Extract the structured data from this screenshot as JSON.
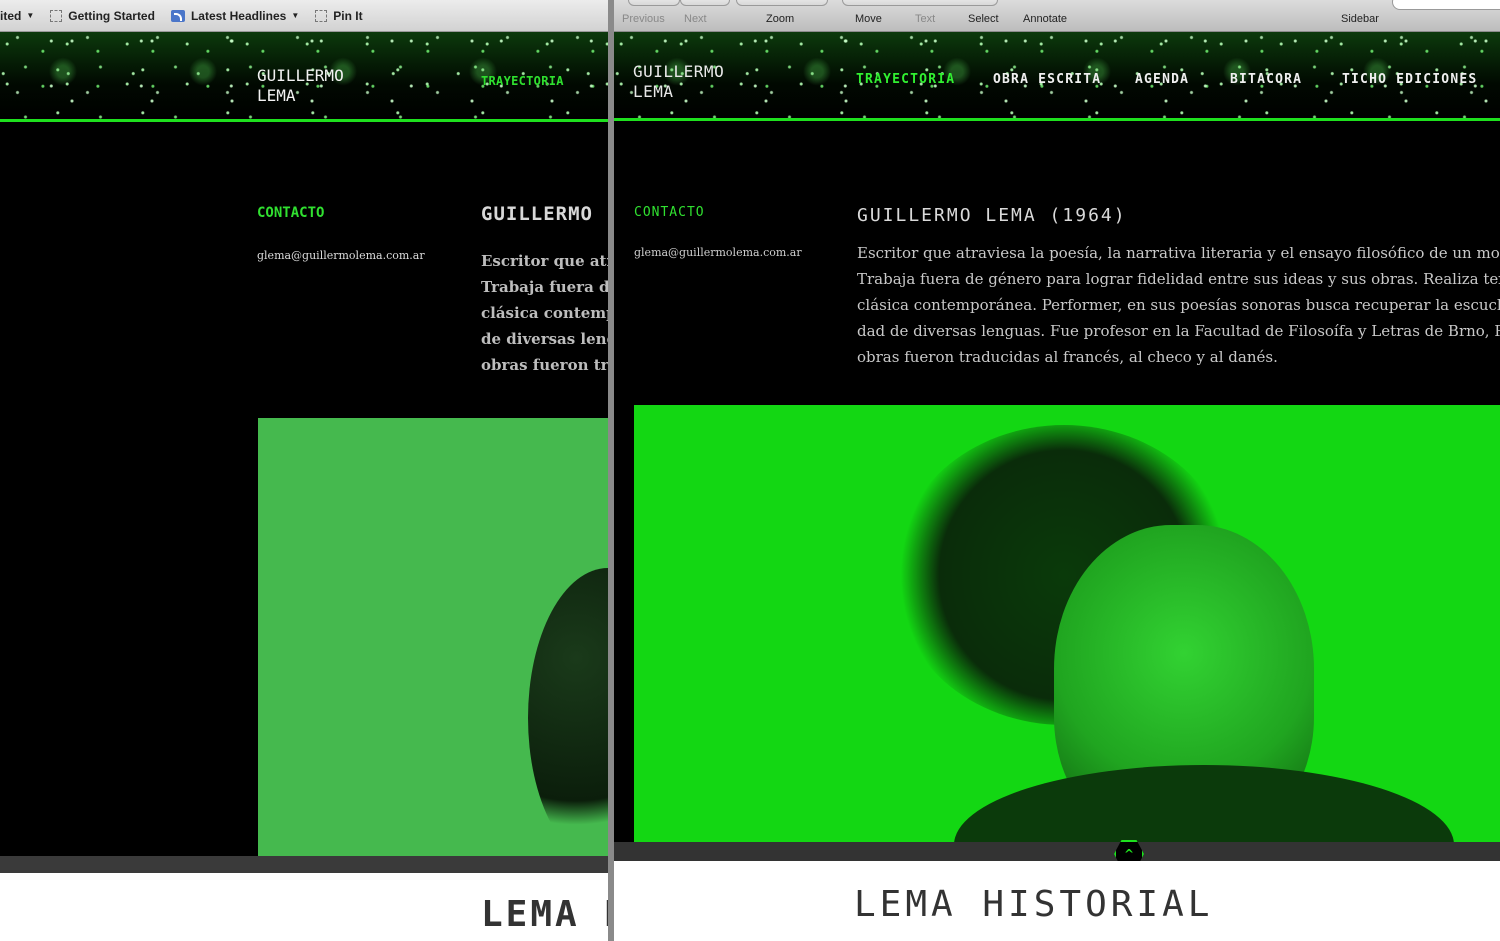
{
  "left_window": {
    "bookmarks": [
      {
        "label": "ited",
        "type": "folder"
      },
      {
        "label": "Getting Started",
        "type": "page"
      },
      {
        "label": "Latest Headlines",
        "type": "rss"
      },
      {
        "label": "Pin It",
        "type": "page"
      }
    ],
    "site": {
      "logo_line1": "GUILLERMO",
      "logo_line2": "LEMA",
      "nav_active": "TRAYECTORIA",
      "contact_heading": "CONTACTO",
      "email": "glema@guillermolema.com.ar",
      "name_heading": "GUILLERMO",
      "bio_lines": [
        "Escritor que atrav",
        "Trabaja fuera de g",
        "clásica contempo",
        "de diversas lengu",
        "obras fueron trad"
      ],
      "footer_title": "LEMA H"
    }
  },
  "right_window": {
    "toolbar": {
      "previous": "Previous",
      "next": "Next",
      "zoom": "Zoom",
      "move": "Move",
      "text": "Text",
      "select": "Select",
      "annotate": "Annotate",
      "sidebar": "Sidebar"
    },
    "site": {
      "logo_line1": "GUILLERMO",
      "logo_line2": "LEMA",
      "nav": [
        "TRAYECTORIA",
        "OBRA ESCRITA",
        "AGENDA",
        "BITACORA",
        "TICHO EDICIONES"
      ],
      "contact_heading": "CONTACTO",
      "email": "glema@guillermolema.com.ar",
      "name_heading": "GUILLERMO LEMA (1964)",
      "bio_lines": [
        "Escritor que atraviesa la poesía, la narrativa literaria  y el ensayo filosófico de un modo s",
        "Trabaja fuera de género para lograr fidelidad entre sus ideas y sus obras. Realiza textos p",
        "clásica contemporánea. Performer, en sus poesías sonoras busca recuperar la escucha d",
        "dad de diversas lenguas. Fue profesor en la Facultad de Filosoífa y Letras de Brno, Repú",
        "obras fueron traducidas al francés, al checo y al danés."
      ],
      "footer_title": "LEMA HISTORIAL",
      "scroll_up": "^"
    }
  },
  "colors": {
    "accent_green": "#1ee01e",
    "photo_green": "#13d713"
  }
}
